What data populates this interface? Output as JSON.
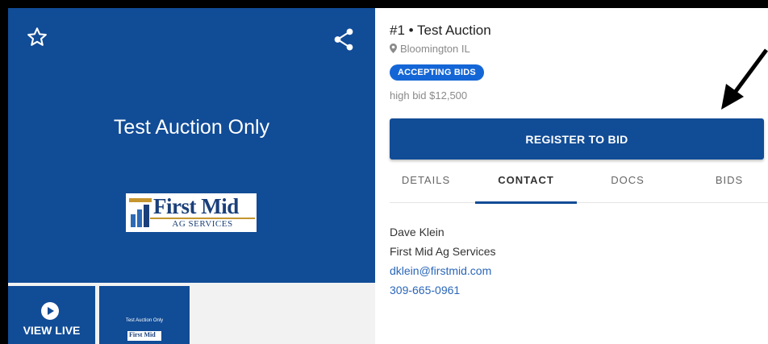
{
  "hero": {
    "title": "Test Auction Only",
    "logo": {
      "name": "First Mid",
      "subtitle": "AG SERVICES"
    }
  },
  "thumbnails": {
    "view_live_label": "VIEW LIVE",
    "mini_title": "Test Auction Only",
    "mini_logo": "First Mid"
  },
  "lot": {
    "title": "#1 • Test Auction",
    "location": "Bloomington IL",
    "status_badge": "ACCEPTING BIDS",
    "high_bid": "high bid $12,500",
    "register_label": "REGISTER TO BID"
  },
  "tabs": [
    {
      "label": "DETAILS",
      "active": false
    },
    {
      "label": "CONTACT",
      "active": true
    },
    {
      "label": "DOCS",
      "active": false
    },
    {
      "label": "BIDS",
      "active": false
    }
  ],
  "contact": {
    "name": "Dave Klein",
    "company": "First Mid Ag Services",
    "email": "dklein@firstmid.com",
    "phone": "309-665-0961"
  },
  "colors": {
    "brand_blue": "#114c96",
    "badge_blue": "#1466d6",
    "link_blue": "#2a66b8",
    "logo_gold": "#c5962f"
  }
}
